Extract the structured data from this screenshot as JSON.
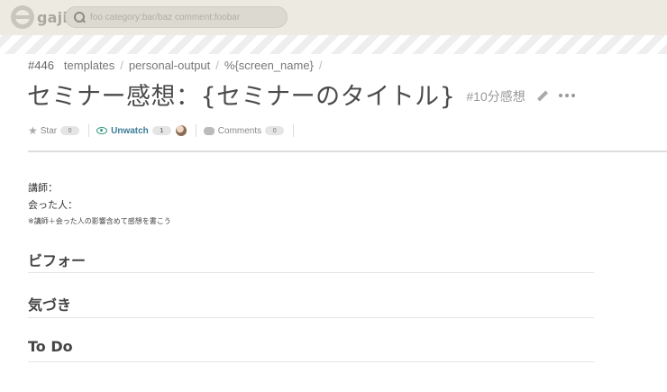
{
  "header": {
    "logo_text": "gaji",
    "search": {
      "placeholder": "foo category:bar/baz comment:foobar",
      "value": ""
    }
  },
  "breadcrumb": {
    "number": "#446",
    "items": [
      "templates",
      "personal-output",
      "%{screen_name}"
    ],
    "separator": "/"
  },
  "post": {
    "title": "セミナー感想：{セミナーのタイトル}",
    "tag": "#10分感想"
  },
  "actions": {
    "star_label": "Star",
    "star_count": "0",
    "watch_label": "Unwatch",
    "watch_count": "1",
    "comments_label": "Comments",
    "comments_count": "0"
  },
  "body": {
    "lines": [
      "講師：",
      "会った人：",
      "※講師＋会った人の影響含めて感想を書こう"
    ],
    "sections": [
      "ビフォー",
      "気づき",
      "To Do"
    ]
  },
  "colors": {
    "topbar": "#edebe1",
    "watch_accent": "#3c9a7f",
    "link": "#3b7b98"
  }
}
